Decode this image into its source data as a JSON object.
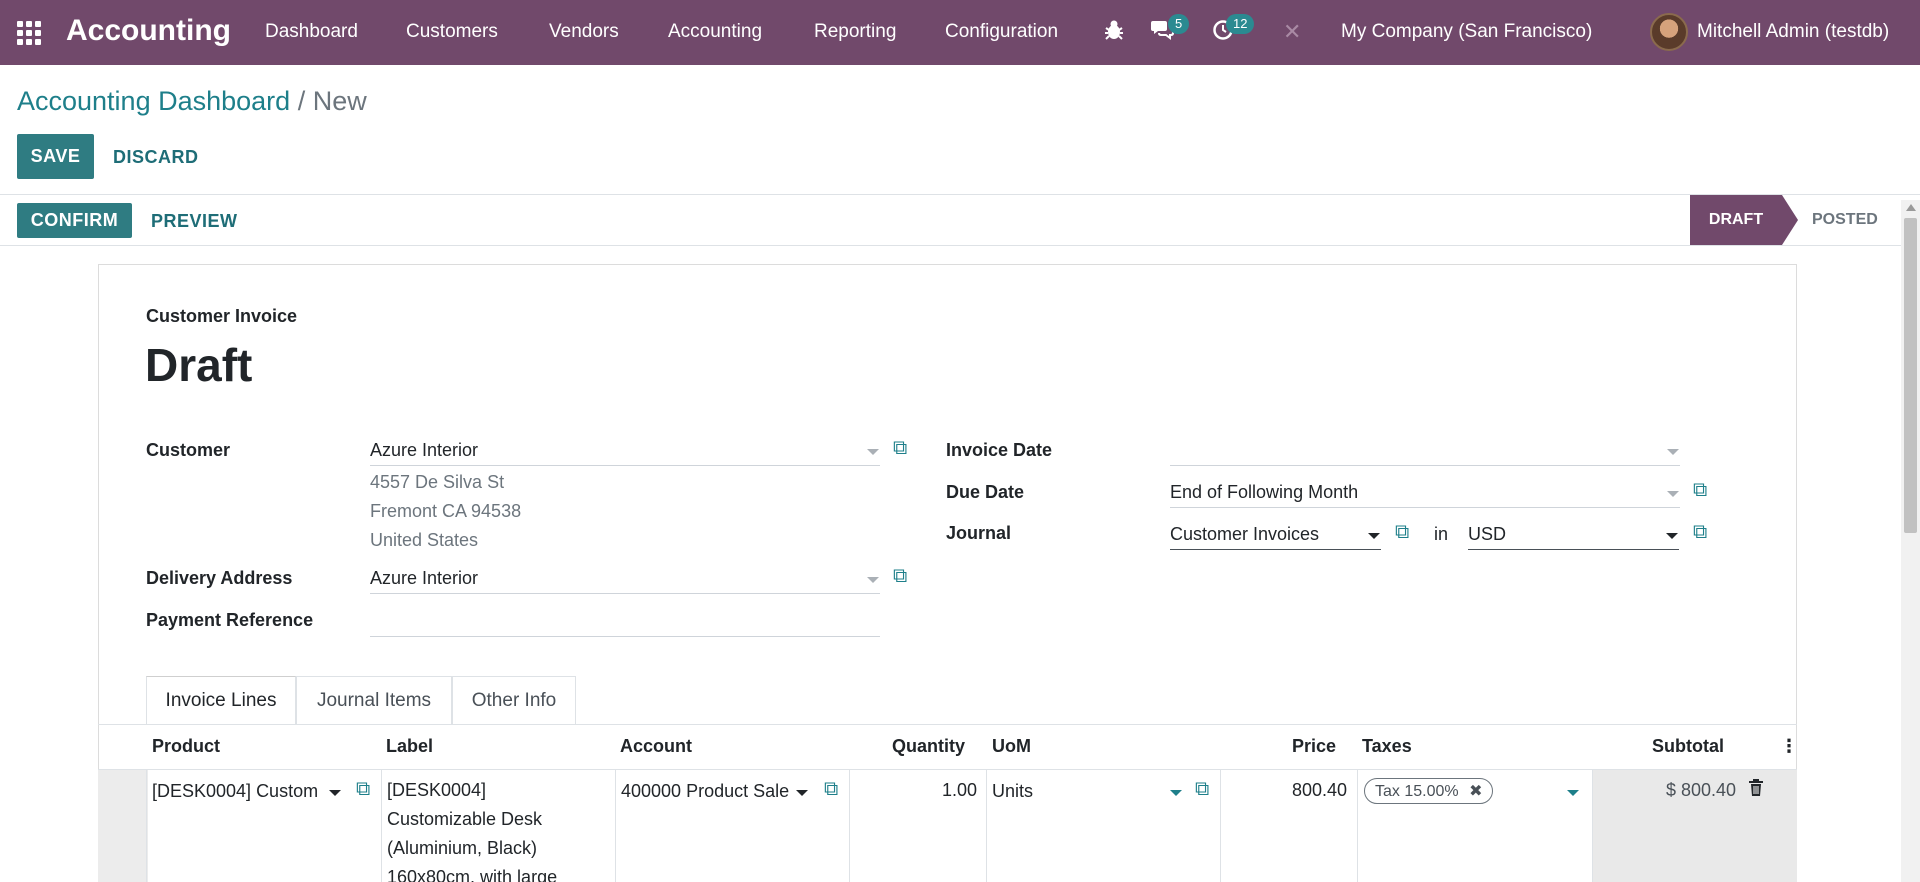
{
  "topbar": {
    "brand": "Accounting",
    "nav": [
      "Dashboard",
      "Customers",
      "Vendors",
      "Accounting",
      "Reporting",
      "Configuration"
    ],
    "messages_count": "5",
    "activities_count": "12",
    "company": "My Company (San Francisco)",
    "user": "Mitchell Admin (testdb)",
    "color": "#71496b"
  },
  "breadcrumb": {
    "parent": "Accounting Dashboard",
    "separator": "/",
    "current": "New"
  },
  "actions": {
    "save": "SAVE",
    "discard": "DISCARD",
    "confirm": "CONFIRM",
    "preview": "PREVIEW"
  },
  "status": {
    "draft": "DRAFT",
    "posted": "POSTED",
    "active": "DRAFT"
  },
  "invoice": {
    "type": "Customer Invoice",
    "title": "Draft",
    "customer_label": "Customer",
    "customer": "Azure Interior",
    "address": [
      "4557 De Silva St",
      "Fremont CA 94538",
      "United States"
    ],
    "delivery_label": "Delivery Address",
    "delivery": "Azure Interior",
    "payment_ref_label": "Payment Reference",
    "payment_ref": "",
    "invoice_date_label": "Invoice Date",
    "invoice_date": "",
    "due_date_label": "Due Date",
    "due_date": "End of Following Month",
    "journal_label": "Journal",
    "journal": "Customer Invoices",
    "in_label": "in",
    "currency": "USD"
  },
  "tabs": [
    "Invoice Lines",
    "Journal Items",
    "Other Info"
  ],
  "lines": {
    "headers": [
      "Product",
      "Label",
      "Account",
      "Quantity",
      "UoM",
      "Price",
      "Taxes",
      "Subtotal"
    ],
    "rows": [
      {
        "product": "[DESK0004] Custom",
        "label": [
          "[DESK0004]",
          "Customizable Desk",
          "(Aluminium, Black)",
          "160x80cm, with large"
        ],
        "account": "400000 Product Sale",
        "quantity": "1.00",
        "uom": "Units",
        "price": "800.40",
        "tax": "Tax 15.00%",
        "subtotal": "$ 800.40"
      }
    ]
  }
}
